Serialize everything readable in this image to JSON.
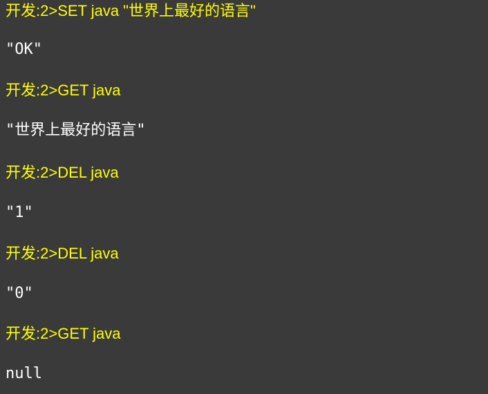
{
  "console": {
    "prompt": "开发:2>",
    "lines": [
      {
        "type": "command",
        "text": "SET java \"世界上最好的语言\""
      },
      {
        "type": "output",
        "text": "\"OK\""
      },
      {
        "type": "command",
        "text": "GET java"
      },
      {
        "type": "output",
        "text": "\"世界上最好的语言\""
      },
      {
        "type": "command",
        "text": "DEL java"
      },
      {
        "type": "output",
        "text": "\"1\""
      },
      {
        "type": "command",
        "text": "DEL java"
      },
      {
        "type": "output",
        "text": "\"0\""
      },
      {
        "type": "command",
        "text": "GET java"
      },
      {
        "type": "output",
        "text": "null"
      }
    ]
  },
  "colors": {
    "background": "#3a3a3a",
    "command": "#ffff00",
    "output": "#ffffff"
  }
}
